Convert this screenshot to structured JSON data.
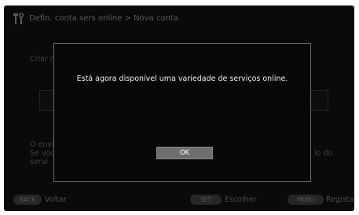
{
  "header": {
    "title": "Defin. conta sers online > Nova conta",
    "icon": "tools-icon"
  },
  "background": {
    "line1": "Criar n",
    "line2_left": "O envi",
    "line3_left": "Se voc",
    "line3_right": "lo do",
    "line4_left": "servi"
  },
  "dialog": {
    "message": "Está agora disponível uma variedade de serviços online.",
    "ok_label": "OK"
  },
  "footer": {
    "back_key": "BACK",
    "back_label": "Voltar",
    "set_key": "SET",
    "set_label": "Escolher",
    "menu_key": "MENU",
    "menu_label": "Registar"
  }
}
